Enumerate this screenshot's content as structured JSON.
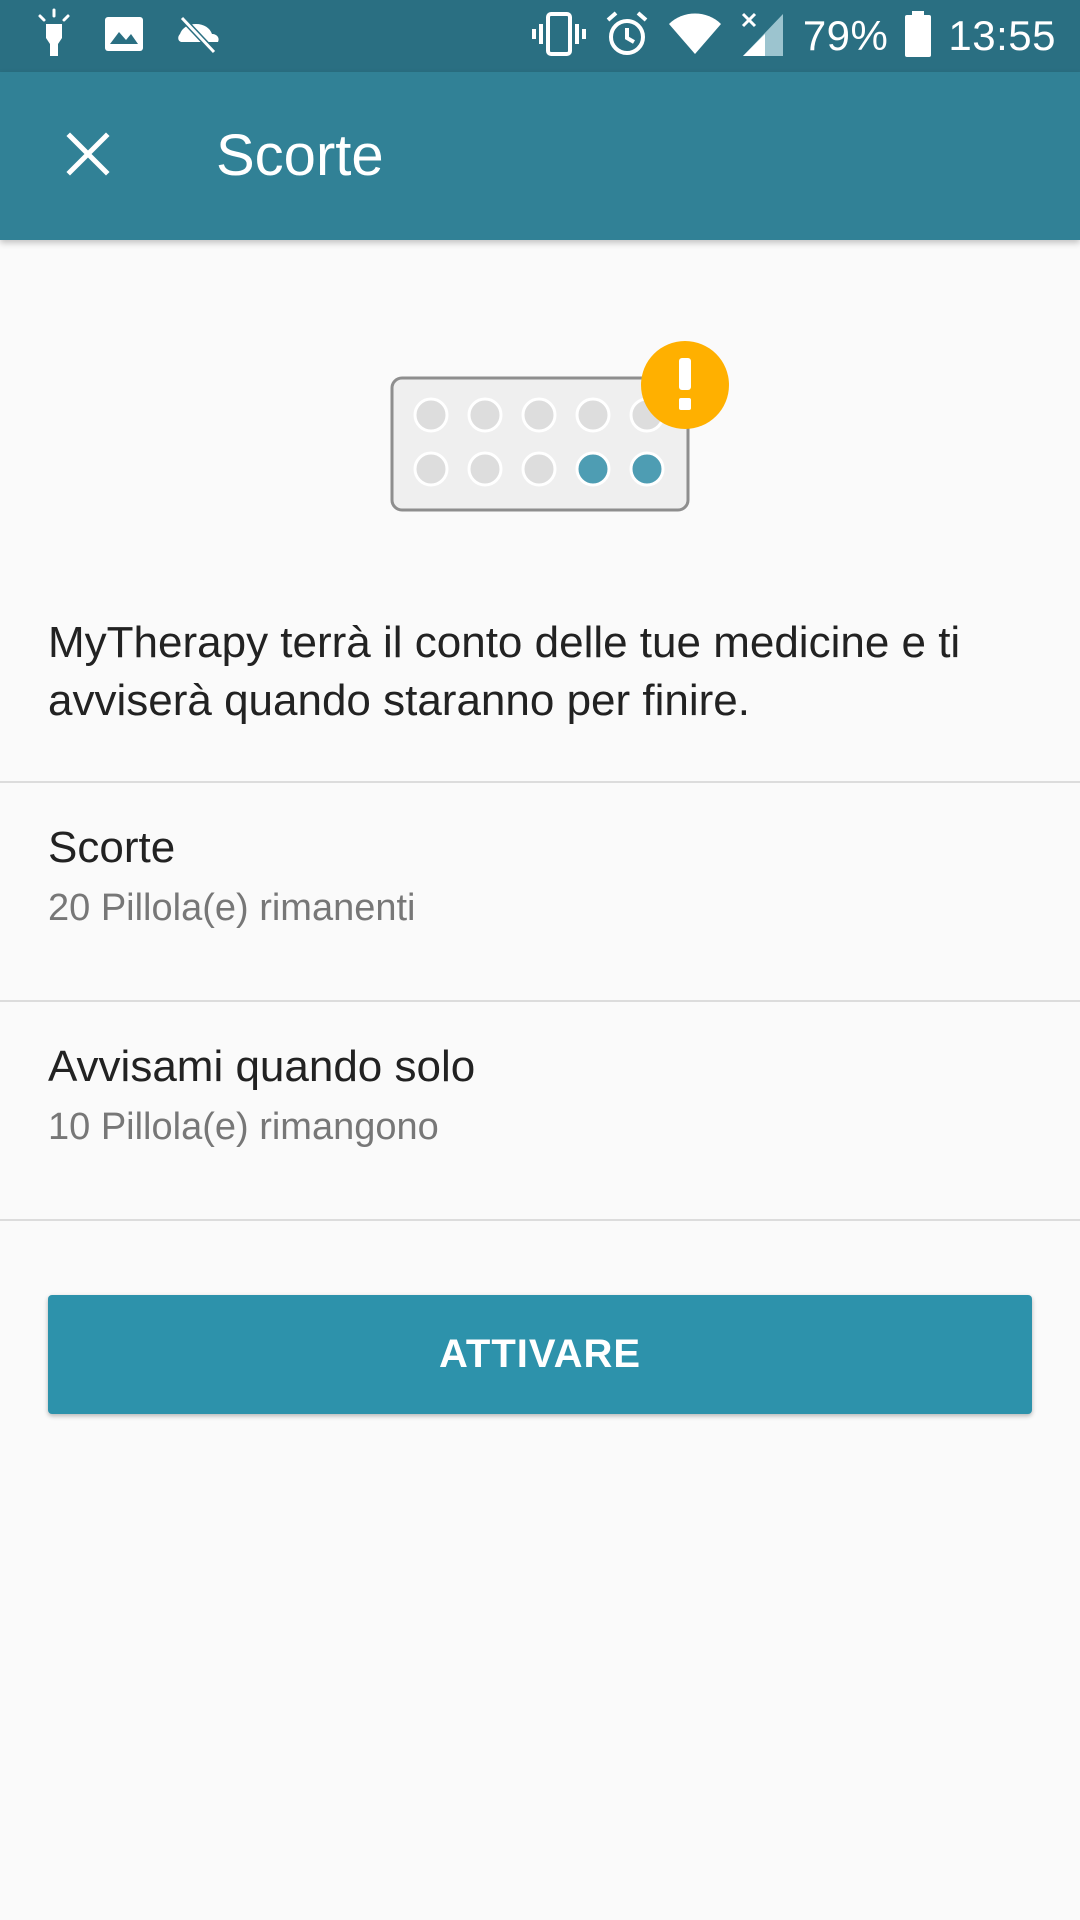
{
  "status_bar": {
    "battery_percent": "79%",
    "time": "13:55",
    "left_icons": [
      "torch-icon",
      "image-icon",
      "sync-off-icon"
    ],
    "right_icons": [
      "vibrate-icon",
      "alarm-icon",
      "wifi-icon",
      "signal-icon",
      "battery-icon"
    ]
  },
  "app_bar": {
    "title": "Scorte",
    "close_icon": "close-icon"
  },
  "illustration": {
    "icon": "pill-blister-icon",
    "badge_icon": "exclamation-badge-icon",
    "pills_total": 10,
    "pills_remaining": 2,
    "colors": {
      "pill_empty": "#dddddd",
      "pill_full": "#4e9db3",
      "badge": "#ffb000"
    }
  },
  "intro_text": "MyTherapy terrà il conto delle tue medicine e ti avviserà quando staranno per finire.",
  "settings": [
    {
      "title": "Scorte",
      "subtitle": "20 Pillola(e) rimanenti"
    },
    {
      "title": "Avvisami quando solo",
      "subtitle": "10 Pillola(e) rimangono"
    }
  ],
  "cta": {
    "label": "ATTIVARE"
  },
  "colors": {
    "status_bar": "#2a6f82",
    "app_bar": "#318196",
    "button": "#2d92ab",
    "background": "#fafafa"
  }
}
